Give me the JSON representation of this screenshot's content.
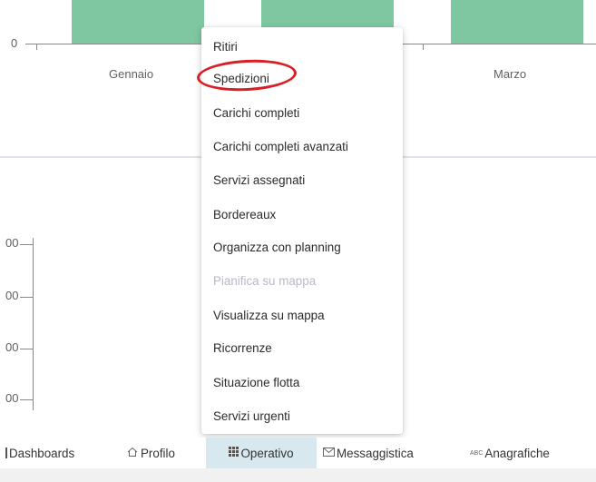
{
  "colors": {
    "bar": "#7fc7a0",
    "accent_ring": "#d81f26",
    "active_nav_bg": "#d7e8ee",
    "disabled_text": "#b8bac8"
  },
  "top_chart": {
    "y_tick_label": "0",
    "categories": [
      "Gennaio",
      "",
      "Marzo"
    ]
  },
  "bottom_chart": {
    "y_tick_labels": [
      "00",
      "00",
      "00",
      "00"
    ]
  },
  "menu": {
    "items": [
      {
        "label": "Ritiri",
        "enabled": true
      },
      {
        "label": "Spedizioni",
        "enabled": true,
        "highlighted": true
      },
      {
        "label": "Carichi completi",
        "enabled": true
      },
      {
        "label": "Carichi completi avanzati",
        "enabled": true
      },
      {
        "label": "Servizi assegnati",
        "enabled": true
      },
      {
        "label": "Bordereaux",
        "enabled": true
      },
      {
        "label": "Organizza con planning",
        "enabled": true
      },
      {
        "label": "Pianifica su mappa",
        "enabled": false
      },
      {
        "label": "Visualizza su mappa",
        "enabled": true
      },
      {
        "label": "Ricorrenze",
        "enabled": true
      },
      {
        "label": "Situazione flotta",
        "enabled": true
      },
      {
        "label": "Servizi urgenti",
        "enabled": true
      }
    ]
  },
  "nav": {
    "items": [
      {
        "label": "Dashboards",
        "icon": "dashboard-icon",
        "active": false
      },
      {
        "label": "Profilo",
        "icon": "home-icon",
        "active": false
      },
      {
        "label": "Operativo",
        "icon": "grid-icon",
        "active": true
      },
      {
        "label": "Messaggistica",
        "icon": "mail-icon",
        "active": false
      },
      {
        "label": "Anagrafiche",
        "icon": "abc-icon",
        "active": false
      }
    ]
  }
}
